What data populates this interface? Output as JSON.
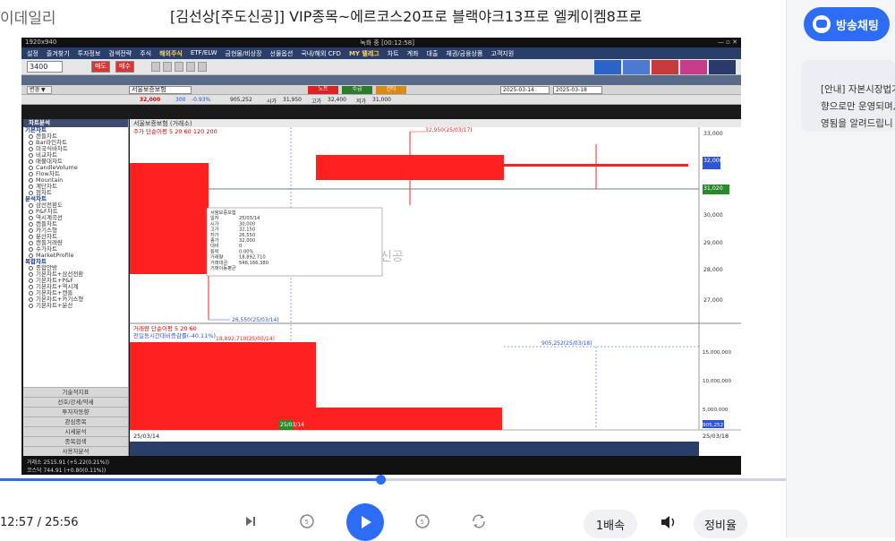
{
  "brand": "이데일리",
  "title": "[김선상[주도신공]] VIP종목~에르코스20프로 블랙야크13프로 엘케이켐8프로",
  "chat_button": "방송채팅",
  "notice": {
    "line1": "[안내] 자본시장법기",
    "line2": "향으로만 운영되며,",
    "line3": "영됨을 알려드립니"
  },
  "video": {
    "top_left": "1920x940",
    "top_center": "녹화 중 [00:12:58]",
    "menu": [
      "설정",
      "즐겨찾기",
      "투자정보",
      "검색전략",
      "주식",
      "해외주식",
      "ETF/ELW",
      "금현물/비상장",
      "선물옵션",
      "국내/해외 CFD",
      "MY 텔레그",
      "차트",
      "계좌",
      "대출",
      "채권/금융상품",
      "고객지원"
    ],
    "code": "3400",
    "toolbar_btns": [
      "매도",
      "매수"
    ],
    "stock_name": "서울보증보험",
    "price": "32,000",
    "change": "300",
    "rate": "-0.93%",
    "volume": "905,252",
    "ohlc": [
      {
        "label": "시가",
        "value": "31,950"
      },
      {
        "label": "고가",
        "value": "32,400"
      },
      {
        "label": "저가",
        "value": "31,000"
      }
    ],
    "date_from": "2025-03-14",
    "date_to": "2025-03-18",
    "chart_header": "서울보증보험 (거래소)",
    "ma_label": "주가 단순이평 5 20 60 120 200",
    "vol_label": "거래량 단순이평 5 20 60",
    "vol_sub": "전일동시간대비증감률(-40.11%)",
    "date_left": "25/03/14",
    "date_mid": "25/03/14",
    "date_right": "25/03/18",
    "ann_high": "32,950(25/03/17)",
    "ann_low": "26,550(25/03/14)",
    "ann_vol_high": "18,892,710(25/03/14)",
    "ann_vol_right": "905,252(25/03/18)",
    "yaxis": [
      "33,000",
      "32,000",
      "31,020",
      "30,000",
      "29,000",
      "28,000",
      "27,000"
    ],
    "yaxis_vol": [
      "15,000,000",
      "10,000,000",
      "5,000,000",
      "905,252"
    ],
    "watermark": "신공",
    "tooltip": [
      {
        "k": "",
        "v": "서울보증보험"
      },
      {
        "k": "일자",
        "v": "25/03/14"
      },
      {
        "k": "시가",
        "v": "30,000"
      },
      {
        "k": "고가",
        "v": "32,150"
      },
      {
        "k": "저가",
        "v": "26,550"
      },
      {
        "k": "종가",
        "v": "32,000"
      },
      {
        "k": "대비",
        "v": "0"
      },
      {
        "k": "등락",
        "v": "0.00%"
      },
      {
        "k": "거래량",
        "v": "18,892,710"
      },
      {
        "k": "거래대금",
        "v": "546,166,380"
      },
      {
        "k": "",
        "v": "거래이동평균"
      }
    ],
    "sidebar": {
      "header": "차트분석",
      "sec1": "기본차트",
      "items1": [
        "캔들차트",
        "Bar라인차트",
        "미국식바차트",
        "비교차트",
        "매물대차트",
        "CandleVolume",
        "Flow차트",
        "Mountain",
        "계단차트",
        "점차트"
      ],
      "sec2": "분석차트",
      "items2": [
        "삼선전환도",
        "P&F차트",
        "역시계곡선",
        "캔들차트",
        "카기스형",
        "분산차트",
        "캔들거래량",
        "수가차트",
        "MarketProfile"
      ],
      "sec3": "복합차트",
      "items3": [
        "종합안방",
        "기본차트+삼선전환",
        "기본차트+P&F",
        "기본차트+역시계",
        "기본차트+캔들",
        "기본차트+카기스형",
        "기본차트+분산"
      ],
      "buttons": [
        "기술적지표",
        "선호/강세/약세",
        "투자자동향",
        "관심종목",
        "시세분석",
        "종목검색",
        "사용자분석"
      ]
    },
    "status_bar": {
      "l1": "거래소 2515.91 (+5.22(0.21%))",
      "l2": "코스닥 744.91 (+0.80(0.11%))"
    }
  },
  "player": {
    "time": "12:57 / 25:56",
    "progress": 0.484,
    "speed": "1배속",
    "quality": "정비율"
  },
  "colors": {
    "accent": "#2d6cf5",
    "candle_red": "#ff2020",
    "chart_blue": "#2d56d6"
  }
}
